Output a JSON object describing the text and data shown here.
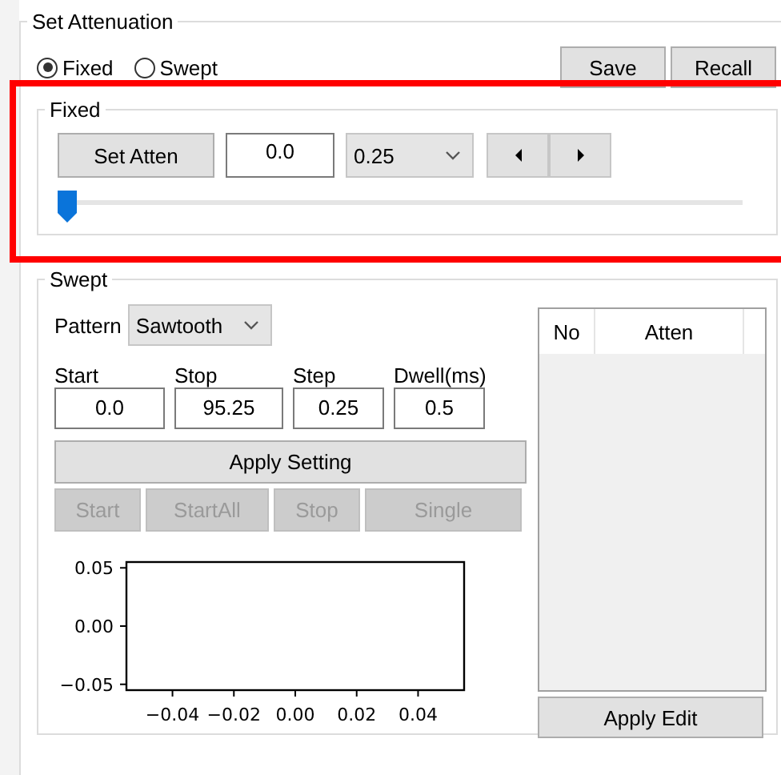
{
  "group": {
    "title": "Set Attenuation"
  },
  "mode": [
    {
      "label": "Fixed",
      "selected": true
    },
    {
      "label": "Swept",
      "selected": false
    }
  ],
  "top_buttons": [
    "Save",
    "Recall"
  ],
  "fixed": {
    "title": "Fixed",
    "button": "Set Atten",
    "value": "0.0",
    "step": "0.25",
    "nudge": [
      {
        "kind": "left"
      },
      {
        "kind": "right"
      }
    ],
    "level": 0
  },
  "swept": {
    "title": "Swept",
    "pattern_label": "Pattern",
    "pattern": "Sawtooth",
    "fields": [
      {
        "label": "Start",
        "value": "0.0"
      },
      {
        "label": "Stop",
        "value": "95.25"
      },
      {
        "label": "Step",
        "value": "0.25"
      },
      {
        "label": "Dwell(ms)",
        "value": "0.5"
      }
    ],
    "apply": "Apply Setting",
    "actions": [
      {
        "label": "Start",
        "disabled": true
      },
      {
        "label": "StartAll",
        "disabled": true
      },
      {
        "label": "Stop",
        "disabled": true
      },
      {
        "label": "Single",
        "disabled": true
      }
    ],
    "chart_data": {
      "type": "line",
      "xlim": [
        -0.055,
        0.055
      ],
      "ylim": [
        -0.055,
        0.055
      ],
      "xticks": [
        {
          "value": -0.04,
          "label": "−0.04"
        },
        {
          "value": -0.02,
          "label": "−0.02"
        },
        {
          "value": 0,
          "label": "0.00"
        },
        {
          "value": 0.02,
          "label": "0.02"
        },
        {
          "value": 0.04,
          "label": "0.04"
        }
      ],
      "yticks": [
        {
          "value": 0.05,
          "label": "0.05"
        },
        {
          "value": 0,
          "label": "0.00"
        },
        {
          "value": -0.05,
          "label": "−0.05"
        }
      ]
    },
    "table": {
      "columns": [
        "No",
        "Atten"
      ]
    },
    "apply_edit": "Apply Edit"
  }
}
